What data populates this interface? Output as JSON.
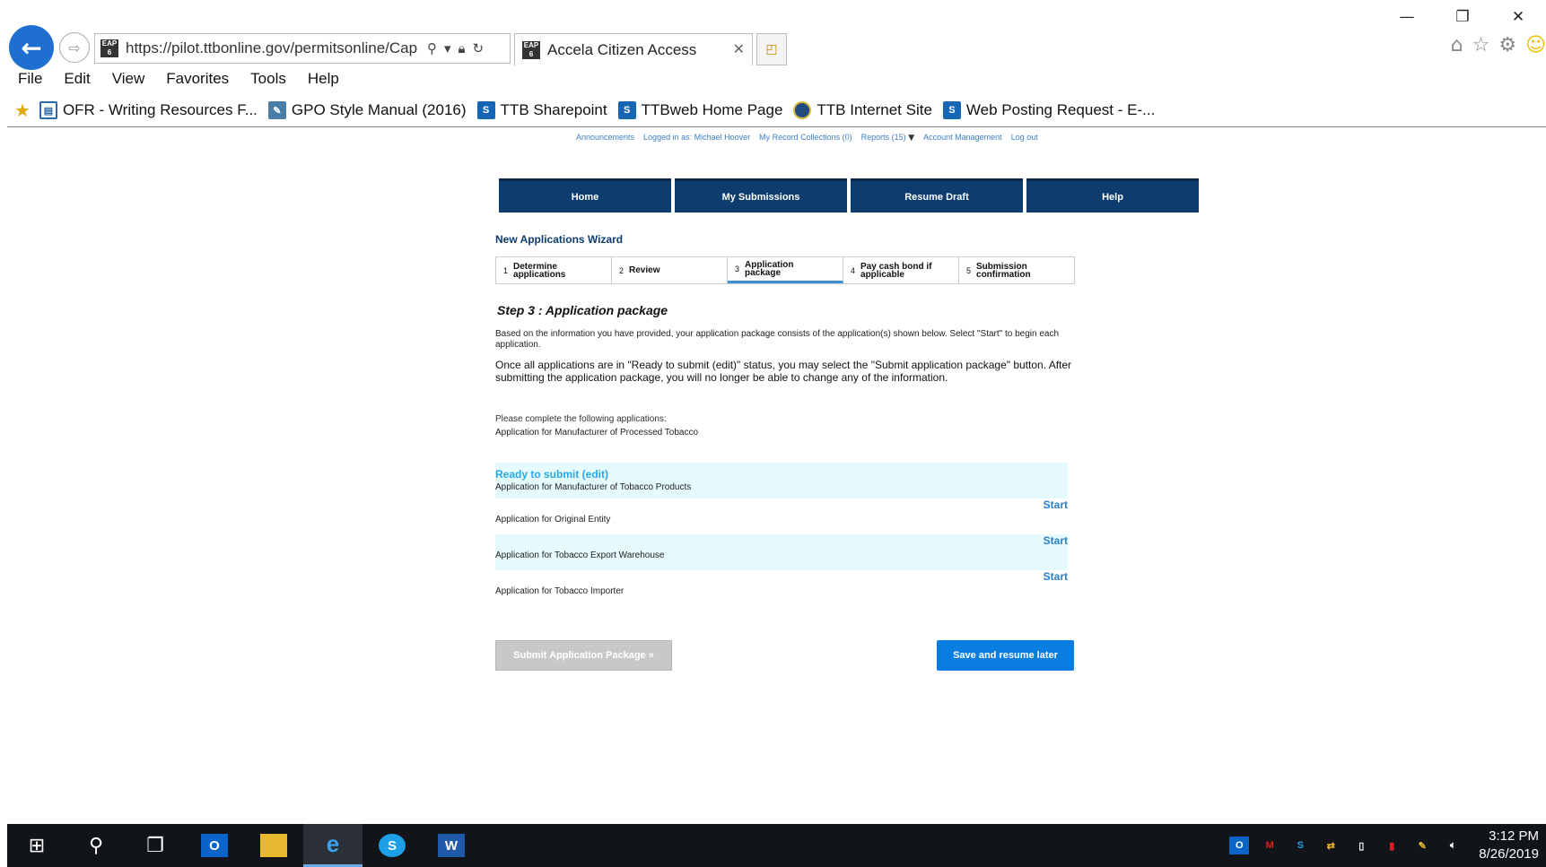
{
  "browser": {
    "url": "https://pilot.ttbonline.gov/permitsonline/Cap",
    "favicon_text": "EAP 6",
    "tab_title": "Accela Citizen Access",
    "menu": [
      "File",
      "Edit",
      "View",
      "Favorites",
      "Tools",
      "Help"
    ],
    "favorites": [
      {
        "label": "OFR - Writing Resources F...",
        "icon": "ofr-icon"
      },
      {
        "label": "GPO Style Manual (2016)",
        "icon": "gpo-icon"
      },
      {
        "label": "TTB Sharepoint",
        "icon": "sharepoint-icon"
      },
      {
        "label": "TTBweb Home Page",
        "icon": "sharepoint-icon"
      },
      {
        "label": "TTB Internet Site",
        "icon": "ttb-seal-icon"
      },
      {
        "label": "Web Posting Request - E-...",
        "icon": "sharepoint-icon"
      }
    ]
  },
  "topnav": {
    "announcements": "Announcements",
    "logged_in": "Logged in as: Michael Hoover",
    "collections": "My Record Collections (0)",
    "reports": "Reports (15)",
    "account": "Account Management",
    "logout": "Log out"
  },
  "mainnav": [
    "Home",
    "My Submissions",
    "Resume Draft",
    "Help"
  ],
  "wizard": {
    "title": "New Applications Wizard",
    "steps": [
      {
        "num": "1",
        "label": "Determine applications"
      },
      {
        "num": "2",
        "label": "Review"
      },
      {
        "num": "3",
        "label": "Application package"
      },
      {
        "num": "4",
        "label": "Pay cash bond if applicable"
      },
      {
        "num": "5",
        "label": "Submission confirmation"
      }
    ],
    "active_step": 3
  },
  "content": {
    "heading": "Step 3 : Application package",
    "intro": "Based on the information you have provided, your application package consists of the application(s) shown below. Select \"Start\" to begin each application.",
    "intro2": "Once all applications are in \"Ready to submit (edit)\" status, you may select the \"Submit application package\" button.  After submitting the application package, you will no longer be able to change any of the information.",
    "complete_label": "Please complete the following applications:",
    "complete_app": "Application for Manufacturer of Processed Tobacco",
    "applications": [
      {
        "status": "Ready to submit (edit)",
        "name": "Application for Manufacturer of Tobacco Products",
        "action": ""
      },
      {
        "status": "",
        "name": "Application for Original Entity",
        "action": "Start"
      },
      {
        "status": "",
        "name": "Application for Tobacco Export Warehouse",
        "action": "Start"
      },
      {
        "status": "",
        "name": "Application for Tobacco Importer",
        "action": "Start"
      }
    ],
    "submit_label": "Submit Application Package »",
    "save_label": "Save and resume later"
  },
  "taskbar": {
    "time": "3:12 PM",
    "date": "8/26/2019"
  },
  "colors": {
    "nav_bg": "#0d3c6e",
    "link": "#3b7fc4",
    "status": "#29a8e8",
    "row_tint": "#e6fbfd",
    "primary_button": "#0a7de0"
  }
}
